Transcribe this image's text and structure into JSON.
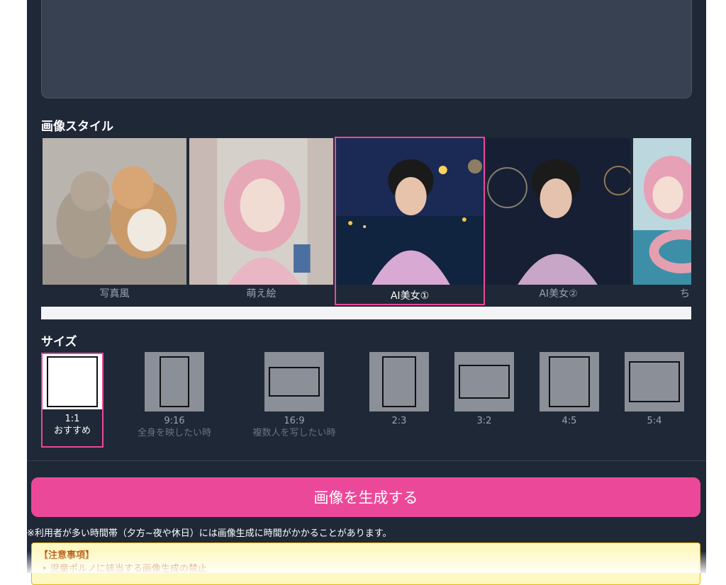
{
  "style_section": {
    "title": "画像スタイル",
    "items": [
      {
        "label": "写真風",
        "image": "kittens-photo",
        "selected": false
      },
      {
        "label": "萌え絵",
        "image": "anime-girl-store",
        "selected": false
      },
      {
        "label": "AI美女①",
        "image": "woman-yukata-night",
        "selected": true
      },
      {
        "label": "AI美女②",
        "image": "woman-yukata-fireworks",
        "selected": false
      },
      {
        "label": "ち",
        "image": "anime-girl-beach",
        "selected": false
      }
    ]
  },
  "size_section": {
    "title": "サイズ",
    "items": [
      {
        "ratio": "1:1",
        "hint": "おすすめ",
        "selected": true
      },
      {
        "ratio": "9:16",
        "hint": "全身を映したい時",
        "selected": false
      },
      {
        "ratio": "16:9",
        "hint": "複数人を写したい時",
        "selected": false
      },
      {
        "ratio": "2:3",
        "hint": "",
        "selected": false
      },
      {
        "ratio": "3:2",
        "hint": "",
        "selected": false
      },
      {
        "ratio": "4:5",
        "hint": "",
        "selected": false
      },
      {
        "ratio": "5:4",
        "hint": "",
        "selected": false
      }
    ]
  },
  "generate_button": {
    "label": "画像を生成する"
  },
  "note": "※利用者が多い時間帯（夕方~夜や休日）には画像生成に時間がかかることがあります。",
  "warning": {
    "title": "【注意事項】",
    "items": [
      "児童ポルノに該当する画像生成の禁止"
    ]
  },
  "colors": {
    "accent": "#ec4899",
    "background": "#1f2837"
  }
}
